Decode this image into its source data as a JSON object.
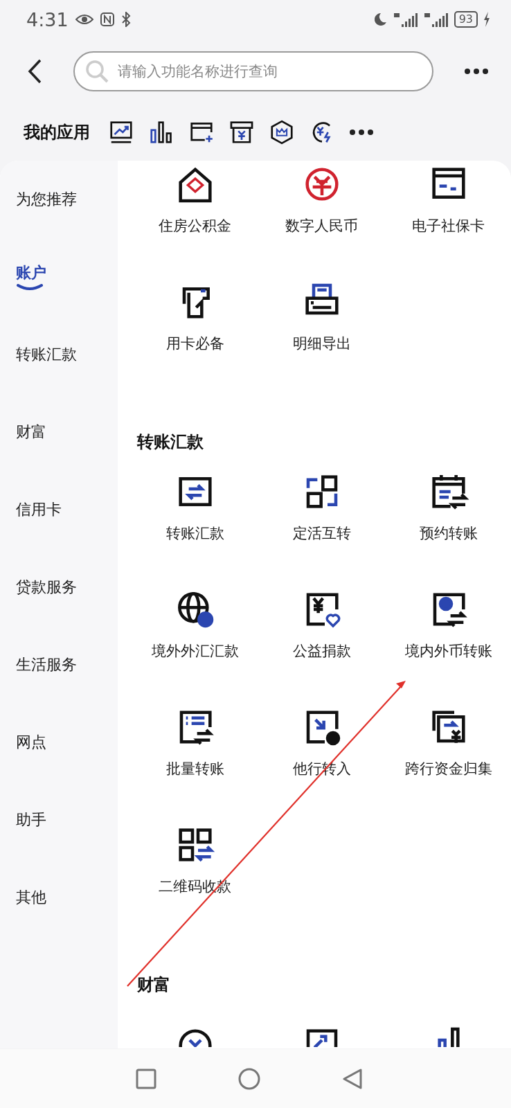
{
  "status_bar": {
    "time": "4:31",
    "battery": "93"
  },
  "search": {
    "placeholder": "请输入功能名称进行查询"
  },
  "my_apps": {
    "title": "我的应用"
  },
  "sidebar": {
    "items": [
      {
        "label": "为您推荐",
        "selected": false
      },
      {
        "label": "账户",
        "selected": true
      },
      {
        "label": "转账汇款",
        "selected": false
      },
      {
        "label": "财富",
        "selected": false
      },
      {
        "label": "信用卡",
        "selected": false
      },
      {
        "label": "贷款服务",
        "selected": false
      },
      {
        "label": "生活服务",
        "selected": false
      },
      {
        "label": "网点",
        "selected": false
      },
      {
        "label": "助手",
        "selected": false
      },
      {
        "label": "其他",
        "selected": false
      }
    ]
  },
  "sections": [
    {
      "items": [
        {
          "label": "住房公积金"
        },
        {
          "label": "数字人民币"
        },
        {
          "label": "电子社保卡"
        },
        {
          "label": "用卡必备"
        },
        {
          "label": "明细导出"
        }
      ]
    },
    {
      "title": "转账汇款",
      "items": [
        {
          "label": "转账汇款"
        },
        {
          "label": "定活互转"
        },
        {
          "label": "预约转账"
        },
        {
          "label": "境外外汇汇款"
        },
        {
          "label": "公益捐款"
        },
        {
          "label": "境内外币转账"
        },
        {
          "label": "批量转账"
        },
        {
          "label": "他行转入"
        },
        {
          "label": "跨行资金归集"
        },
        {
          "label": "二维码收款"
        }
      ]
    },
    {
      "title": "财富"
    }
  ]
}
